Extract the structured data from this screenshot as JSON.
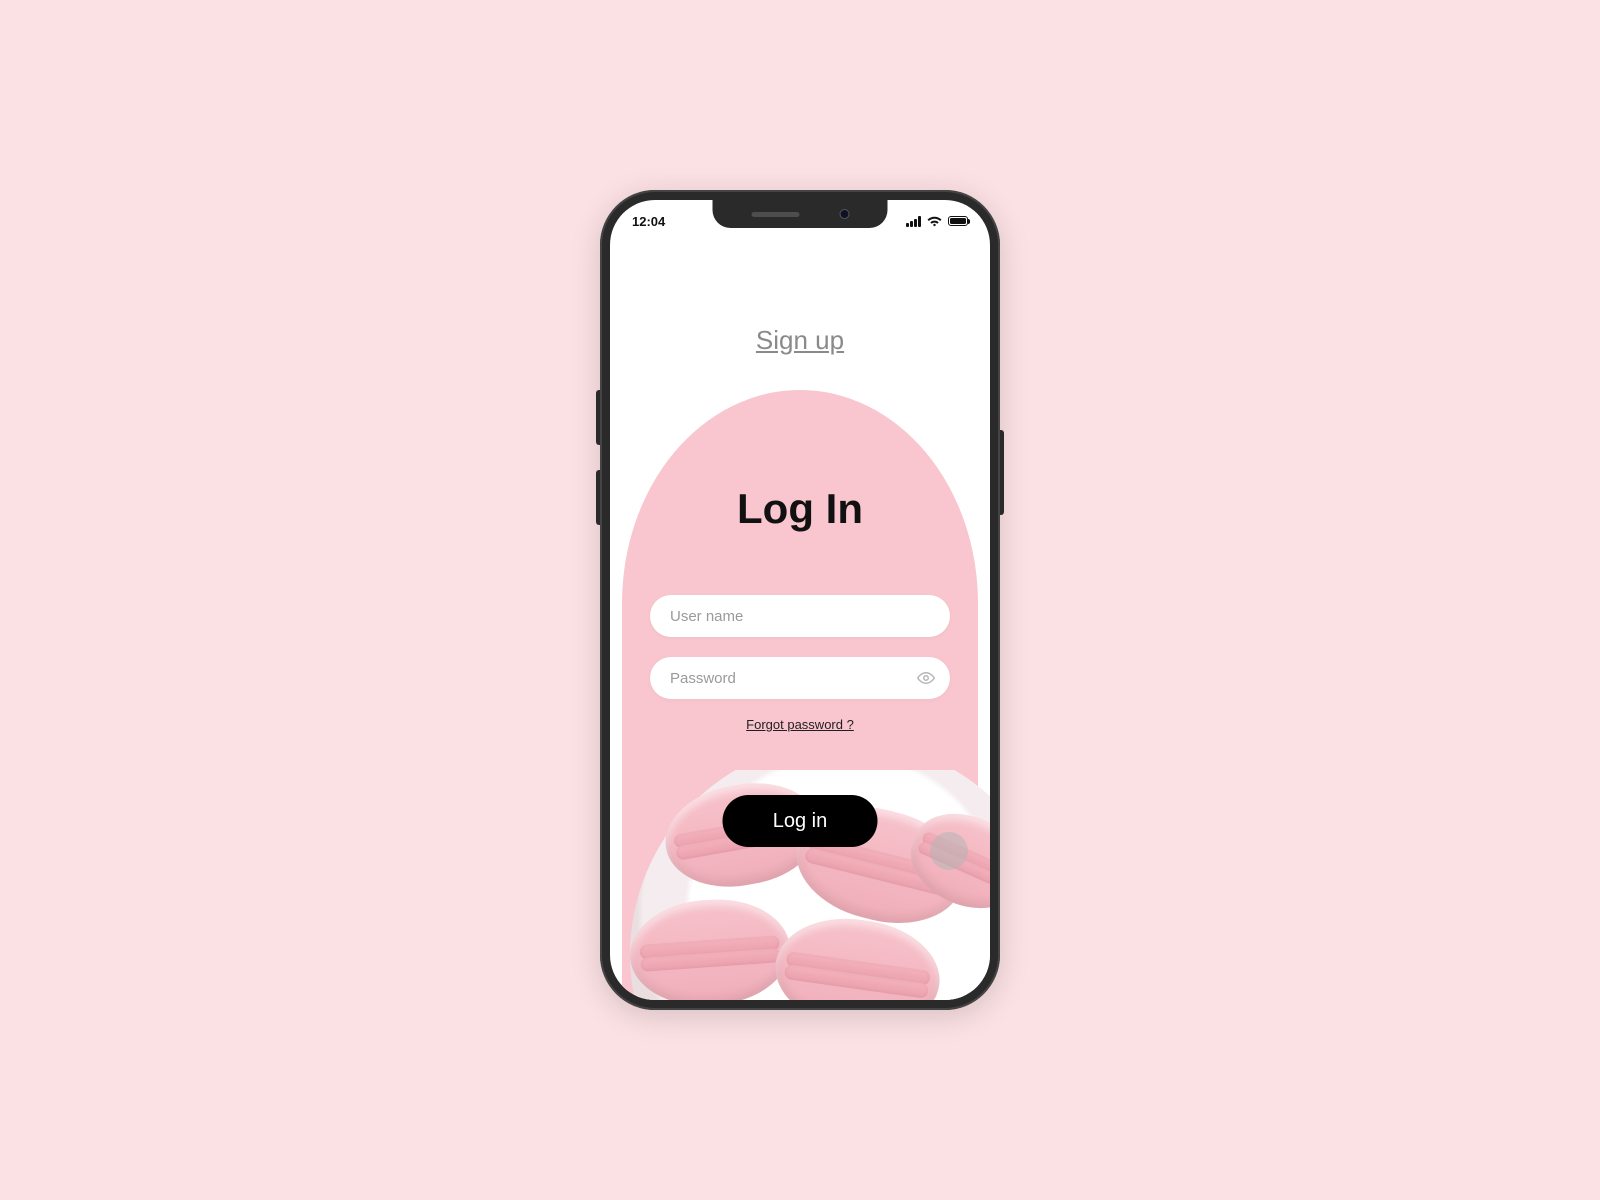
{
  "status": {
    "time": "12:04"
  },
  "nav": {
    "signup_label": "Sign up"
  },
  "login": {
    "title": "Log In",
    "username_placeholder": "User name",
    "password_placeholder": "Password",
    "forgot_label": "Forgot password ?",
    "submit_label": "Log in"
  }
}
